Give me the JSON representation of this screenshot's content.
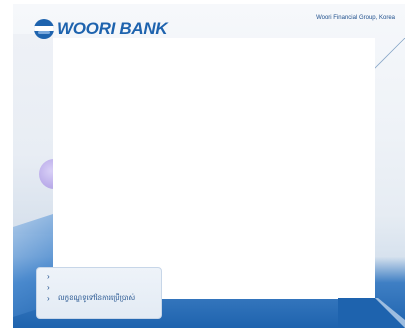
{
  "header": {
    "brand": "WOORI BANK",
    "tagline": "Woori Financial Group, Korea"
  },
  "menu": {
    "items": [
      {
        "label": "",
        "icon": "chevron-right-icon"
      },
      {
        "label": "",
        "icon": "chevron-right-icon"
      },
      {
        "label": "លក្ខខណ្ឌទូទៅនៃការប្រើប្រាស់",
        "icon": "chevron-right-icon"
      }
    ]
  },
  "colors": {
    "brand_blue": "#1e63ae",
    "menu_text": "#1e4f8c"
  }
}
